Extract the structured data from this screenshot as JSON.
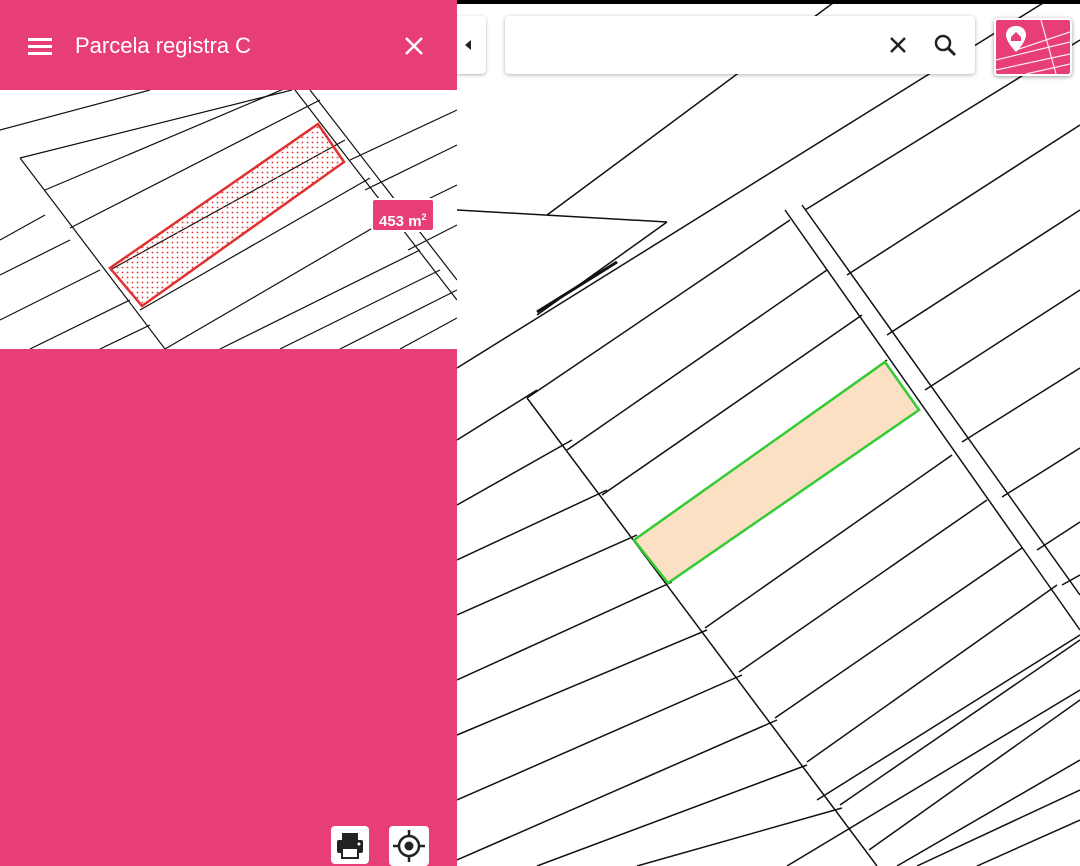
{
  "header": {
    "title": "Parcela registra C"
  },
  "preview": {
    "area_value": "453 m",
    "area_unit_sup": "2"
  },
  "search": {
    "value": "",
    "placeholder": ""
  },
  "icons": {
    "menu": "menu-icon",
    "close": "close-icon",
    "collapse": "triangle-left-icon",
    "clear": "close-icon",
    "search": "search-icon",
    "layers": "map-pin-parcel-icon",
    "print": "printer-icon",
    "locate": "crosshair-gps-icon"
  },
  "colors": {
    "accent": "#e83e78",
    "parcel_fill_map": "#fbe0c4",
    "parcel_stroke_map": "#33cc33",
    "parcel_stroke_preview": "#e03030"
  }
}
